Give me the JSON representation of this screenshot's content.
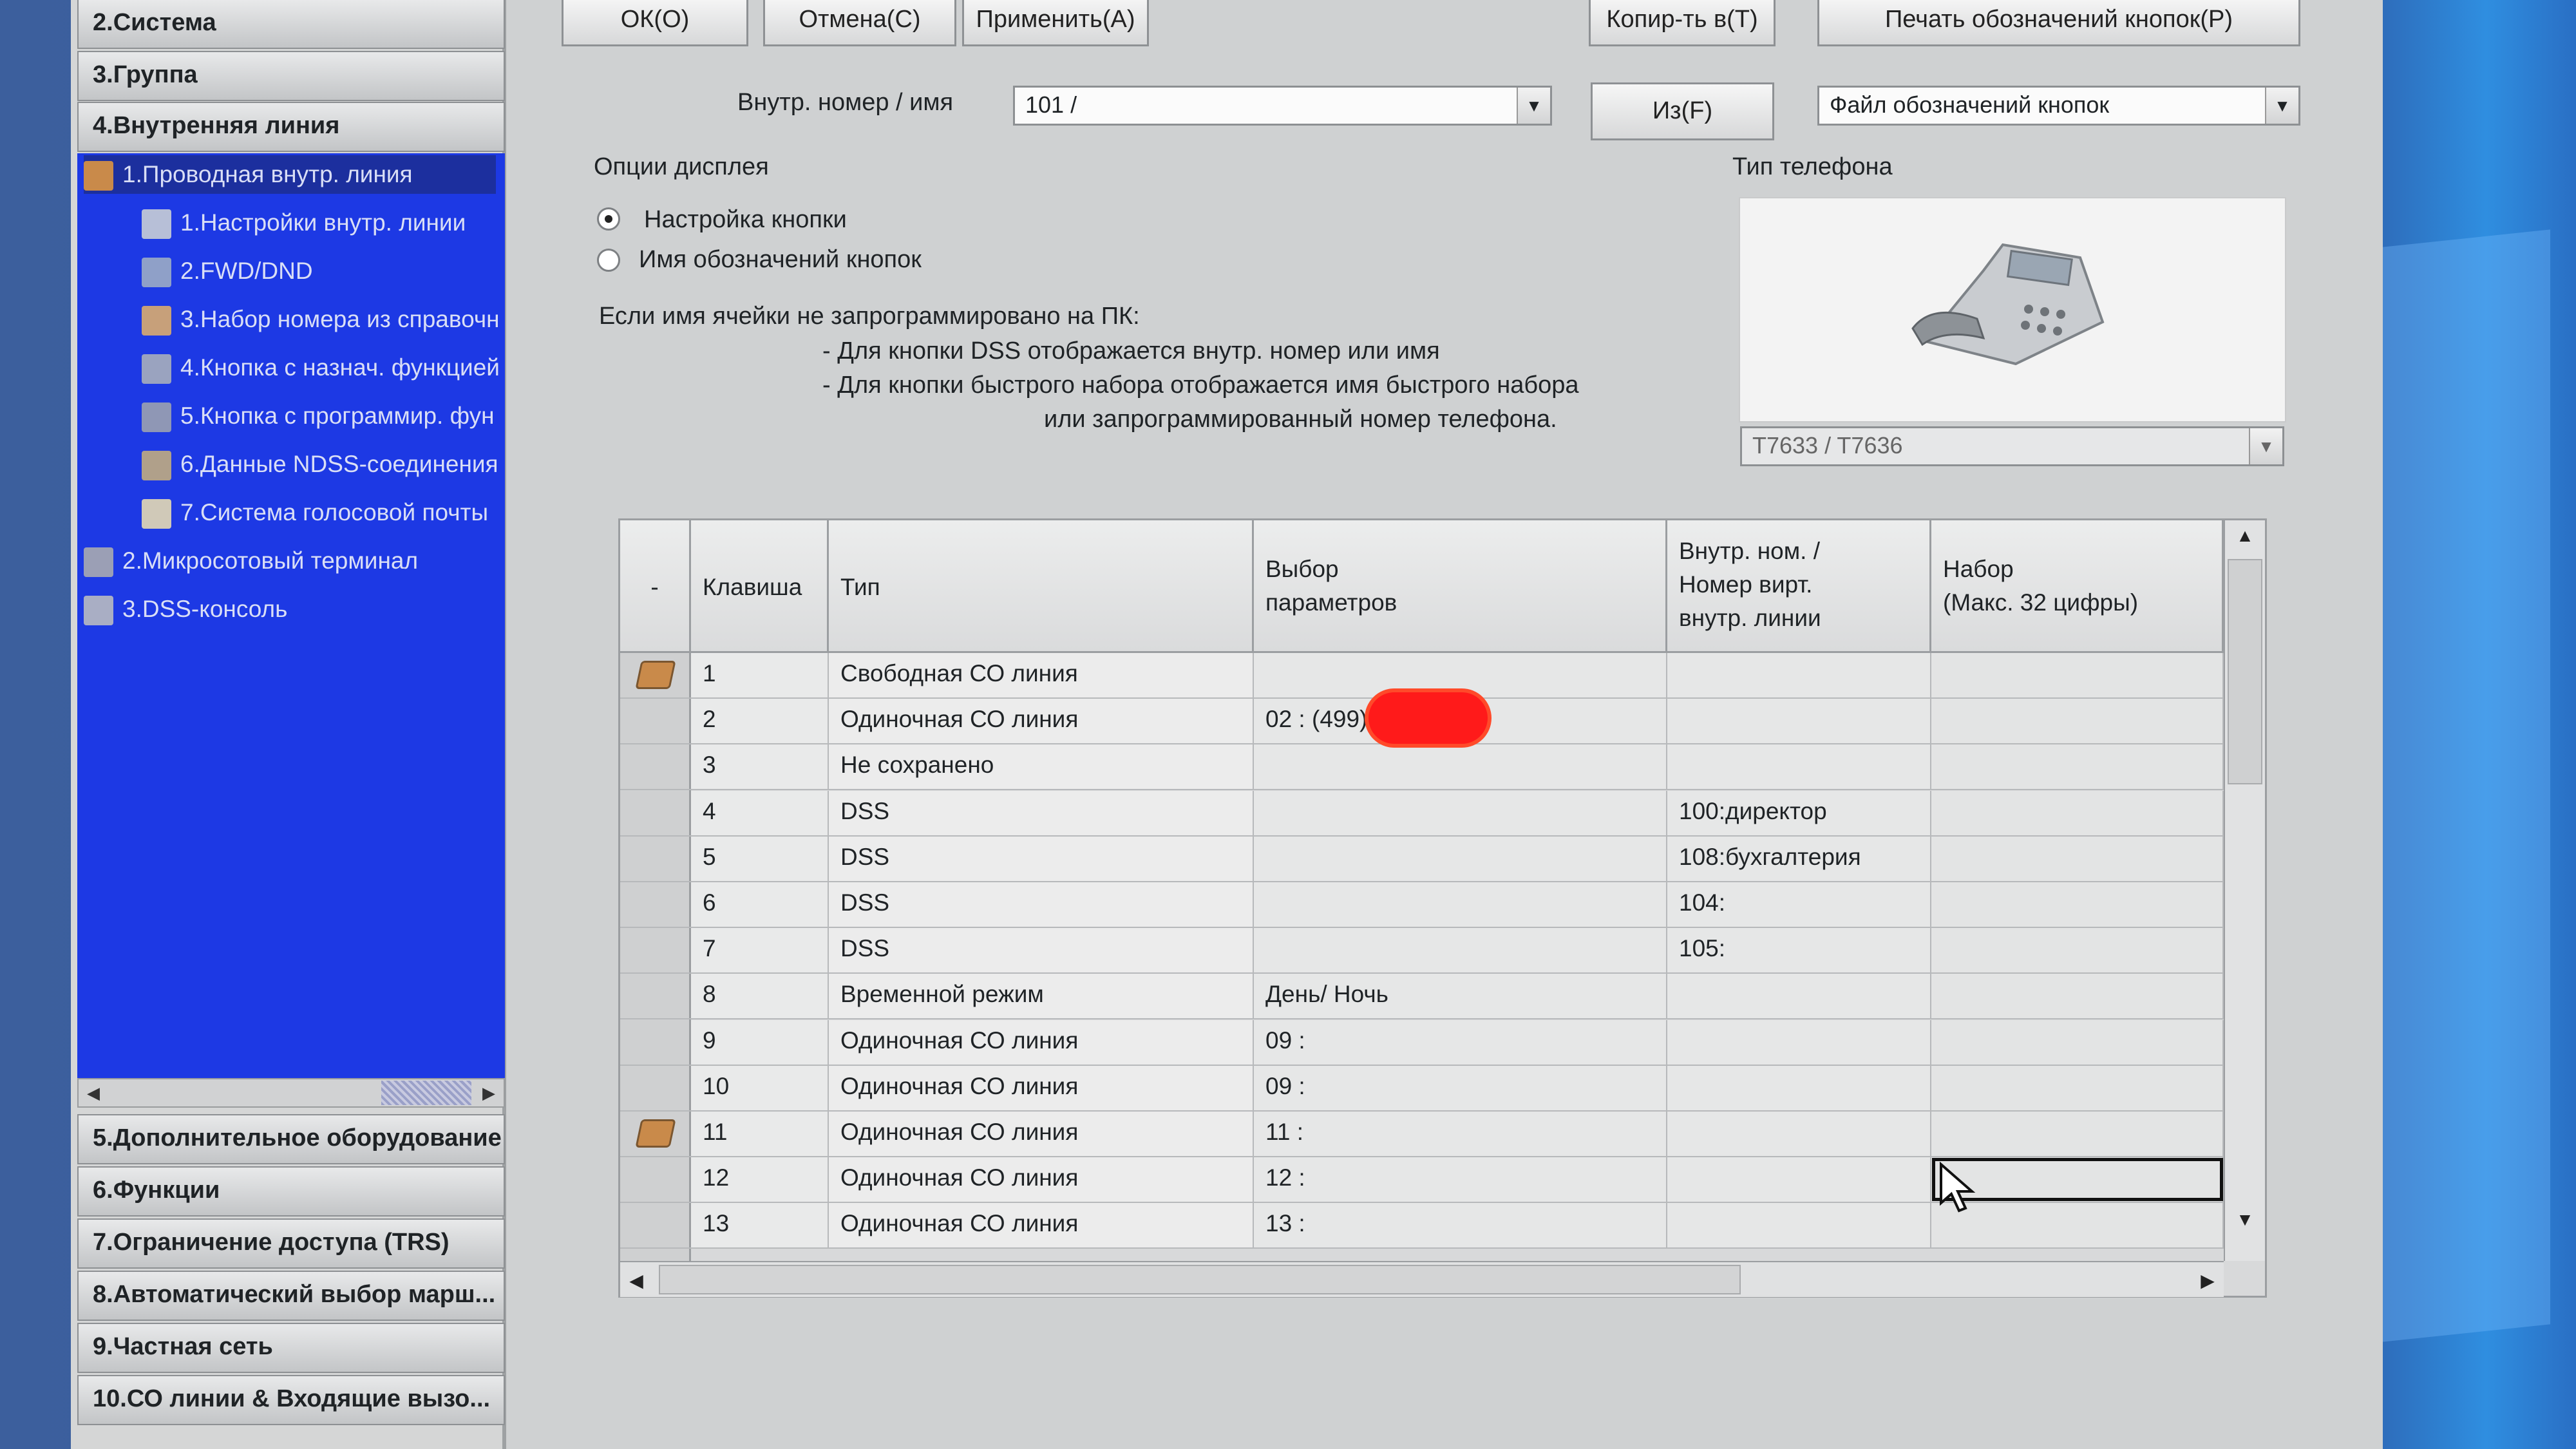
{
  "sidebar": {
    "top_items": [
      "2.Система",
      "3.Группа",
      "4.Внутренняя линия"
    ],
    "tree": [
      {
        "label": "1.Проводная внутр. линия",
        "level": 0,
        "icon": "folder-open-icon"
      },
      {
        "label": "1.Настройки внутр. линии",
        "level": 1,
        "icon": "settings-grid-icon"
      },
      {
        "label": "2.FWD/DND",
        "level": 1,
        "icon": "forward-icon"
      },
      {
        "label": "3.Набор номера из справочн",
        "level": 1,
        "icon": "phonebook-icon"
      },
      {
        "label": "4.Кнопка с назнач. функцией",
        "level": 1,
        "icon": "keypad-icon"
      },
      {
        "label": "5.Кнопка с программир. фун",
        "level": 1,
        "icon": "program-key-icon"
      },
      {
        "label": "6.Данные NDSS-соединения",
        "level": 1,
        "icon": "network-icon"
      },
      {
        "label": "7.Система голосовой почты",
        "level": 1,
        "icon": "voicemail-icon"
      },
      {
        "label": "2.Микросотовый терминал",
        "level": 0,
        "icon": "folder-icon"
      },
      {
        "label": "3.DSS-консоль",
        "level": 0,
        "icon": "dss-console-icon"
      }
    ],
    "bottom_items": [
      "5.Дополнительное оборудование",
      "6.Функции",
      "7.Ограничение доступа (TRS)",
      "8.Автоматический выбор марш...",
      "9.Частная сеть",
      "10.СО линии & Входящие вызо..."
    ]
  },
  "toolbar": {
    "ok": "ОК(О)",
    "cancel": "Отмена(С)",
    "apply": "Применить(А)",
    "copy_to": "Копир-ть в(Т)",
    "print_labels": "Печать обозначений кнопок(Р)"
  },
  "ext_selector": {
    "label": "Внутр. номер / имя",
    "value": "101 /",
    "from_button": "Из(F)",
    "label_file": "Файл обозначений кнопок"
  },
  "display_options": {
    "title": "Опции дисплея",
    "options": [
      {
        "label": "Настройка кнопки",
        "selected": true
      },
      {
        "label": "Имя обозначений кнопок",
        "selected": false
      }
    ],
    "note": [
      "Если имя ячейки не запрограммировано на ПК:",
      "- Для кнопки DSS отображается внутр. номер или имя",
      "- Для кнопки быстрого набора отображается имя быстрого набора",
      "или запрограммированный номер телефона."
    ]
  },
  "phone_type": {
    "title": "Тип телефона",
    "model": "T7633 / T7636",
    "icon": "desk-phone-icon"
  },
  "grid": {
    "columns": {
      "marker": "-",
      "key": "Клавиша",
      "type": "Тип",
      "params": "Выбор\nпараметров",
      "ext": "Внутр. ном. /\nНомер вирт.\nвнутр. линии",
      "dial": "Набор\n(Макс. 32 цифры)"
    },
    "rows": [
      {
        "key": "1",
        "type": "Свободная СО линия",
        "params": "",
        "ext": "",
        "dial": "",
        "marker": true
      },
      {
        "key": "2",
        "type": "Одиночная СО линия",
        "params": "02 : (499)1",
        "ext": "",
        "dial": ""
      },
      {
        "key": "3",
        "type": "Не сохранено",
        "params": "",
        "ext": "",
        "dial": ""
      },
      {
        "key": "4",
        "type": "DSS",
        "params": "",
        "ext": "100:директор",
        "dial": ""
      },
      {
        "key": "5",
        "type": "DSS",
        "params": "",
        "ext": "108:бухгалтерия",
        "dial": ""
      },
      {
        "key": "6",
        "type": "DSS",
        "params": "",
        "ext": "104:",
        "dial": ""
      },
      {
        "key": "7",
        "type": "DSS",
        "params": "",
        "ext": "105:",
        "dial": ""
      },
      {
        "key": "8",
        "type": "Временной режим",
        "params": "День/ Ночь",
        "ext": "",
        "dial": ""
      },
      {
        "key": "9",
        "type": "Одиночная СО линия",
        "params": "09 :",
        "ext": "",
        "dial": ""
      },
      {
        "key": "10",
        "type": "Одиночная СО линия",
        "params": "09 :",
        "ext": "",
        "dial": ""
      },
      {
        "key": "11",
        "type": "Одиночная СО линия",
        "params": "11 :",
        "ext": "",
        "dial": "",
        "marker": true
      },
      {
        "key": "12",
        "type": "Одиночная СО линия",
        "params": "12 :",
        "ext": "",
        "dial": "",
        "focused": true
      },
      {
        "key": "13",
        "type": "Одиночная СО линия",
        "params": "13 :",
        "ext": "",
        "dial": ""
      }
    ]
  },
  "colors": {
    "tree_bg": "#1d39e4",
    "redaction": "#ff1a1a"
  }
}
